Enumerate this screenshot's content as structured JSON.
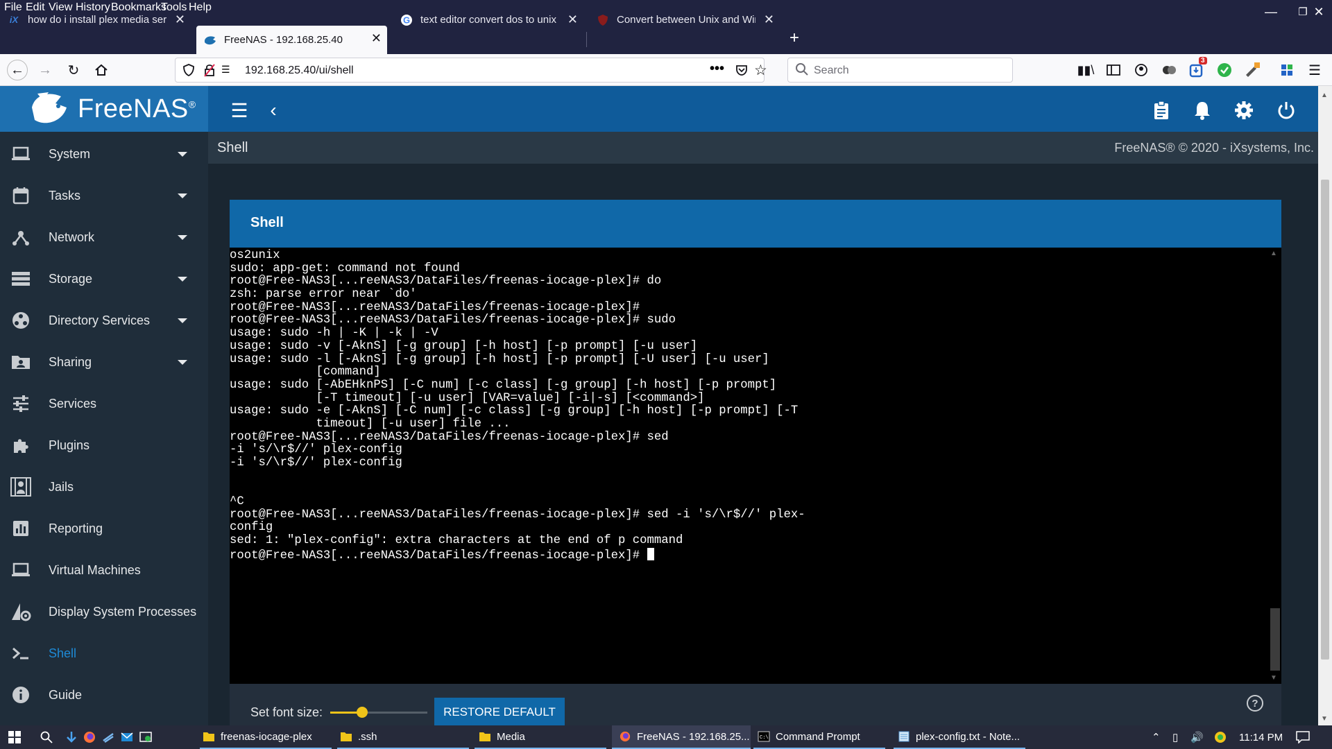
{
  "menubar": {
    "items": [
      "File",
      "Edit",
      "View",
      "History",
      "Bookmarks",
      "Tools",
      "Help"
    ]
  },
  "tabs": [
    {
      "label": "how do i install plex media server",
      "active": false
    },
    {
      "label": "FreeNAS - 192.168.25.40",
      "active": true
    },
    {
      "label": "text editor convert dos to unix",
      "active": false
    },
    {
      "label": "Convert between Unix and Windows",
      "active": false
    }
  ],
  "navbar": {
    "url": "192.168.25.40/ui/shell",
    "search_placeholder": "Search",
    "badge_count": "3",
    "page_actions": "•••"
  },
  "app": {
    "brand": "FreeNAS",
    "brand_mark": "®"
  },
  "sidebar": {
    "items": [
      {
        "label": "System",
        "icon": "laptop-icon",
        "expandable": true
      },
      {
        "label": "Tasks",
        "icon": "calendar-icon",
        "expandable": true
      },
      {
        "label": "Network",
        "icon": "network-icon",
        "expandable": true
      },
      {
        "label": "Storage",
        "icon": "storage-icon",
        "expandable": true
      },
      {
        "label": "Directory Services",
        "icon": "directory-icon",
        "expandable": true
      },
      {
        "label": "Sharing",
        "icon": "sharing-icon",
        "expandable": true
      },
      {
        "label": "Services",
        "icon": "sliders-icon",
        "expandable": false
      },
      {
        "label": "Plugins",
        "icon": "puzzle-icon",
        "expandable": false
      },
      {
        "label": "Jails",
        "icon": "jail-icon",
        "expandable": false
      },
      {
        "label": "Reporting",
        "icon": "chart-icon",
        "expandable": false
      },
      {
        "label": "Virtual Machines",
        "icon": "monitor-icon",
        "expandable": false
      },
      {
        "label": "Display System Processes",
        "icon": "process-icon",
        "expandable": false
      },
      {
        "label": "Shell",
        "icon": "terminal-icon",
        "expandable": false,
        "active": true
      },
      {
        "label": "Guide",
        "icon": "info-icon",
        "expandable": false
      }
    ]
  },
  "page": {
    "title": "Shell",
    "copyright": "FreeNAS® © 2020 - iXsystems, Inc.",
    "card_title": "Shell"
  },
  "terminal": {
    "lines": [
      "os2unix",
      "sudo: app-get: command not found",
      "root@Free-NAS3[...reeNAS3/DataFiles/freenas-iocage-plex]# do",
      "zsh: parse error near `do'",
      "root@Free-NAS3[...reeNAS3/DataFiles/freenas-iocage-plex]#",
      "root@Free-NAS3[...reeNAS3/DataFiles/freenas-iocage-plex]# sudo",
      "usage: sudo -h | -K | -k | -V",
      "usage: sudo -v [-AknS] [-g group] [-h host] [-p prompt] [-u user]",
      "usage: sudo -l [-AknS] [-g group] [-h host] [-p prompt] [-U user] [-u user]",
      "            [command]",
      "usage: sudo [-AbEHknPS] [-C num] [-c class] [-g group] [-h host] [-p prompt]",
      "            [-T timeout] [-u user] [VAR=value] [-i|-s] [<command>]",
      "usage: sudo -e [-AknS] [-C num] [-c class] [-g group] [-h host] [-p prompt] [-T",
      "            timeout] [-u user] file ...",
      "root@Free-NAS3[...reeNAS3/DataFiles/freenas-iocage-plex]# sed",
      "-i 's/\\r$//' plex-config",
      "-i 's/\\r$//' plex-config",
      "",
      "",
      "^C",
      "root@Free-NAS3[...reeNAS3/DataFiles/freenas-iocage-plex]# sed -i 's/\\r$//' plex-",
      "config",
      "sed: 1: \"plex-config\": extra characters at the end of p command",
      "root@Free-NAS3[...reeNAS3/DataFiles/freenas-iocage-plex]# "
    ]
  },
  "font_controls": {
    "label": "Set font size:",
    "font_size_fraction": 0.33,
    "restore_label": "RESTORE DEFAULT"
  },
  "taskbar": {
    "items": [
      {
        "label": "freenas-iocage-plex",
        "icon": "folder-icon"
      },
      {
        "label": ".ssh",
        "icon": "folder-icon"
      },
      {
        "label": "Media",
        "icon": "folder-icon"
      },
      {
        "label": "FreeNAS - 192.168.25...",
        "icon": "firefox-icon"
      },
      {
        "label": "Command Prompt",
        "icon": "cmd-icon"
      },
      {
        "label": "plex-config.txt - Note...",
        "icon": "notepad-icon"
      }
    ],
    "clock": "11:14 PM"
  },
  "colors": {
    "header_blue": "#0f5b9a",
    "sidebar_bg": "#1f2d3a",
    "active_blue": "#1e8ad6",
    "slider_yellow": "#f0c419"
  }
}
